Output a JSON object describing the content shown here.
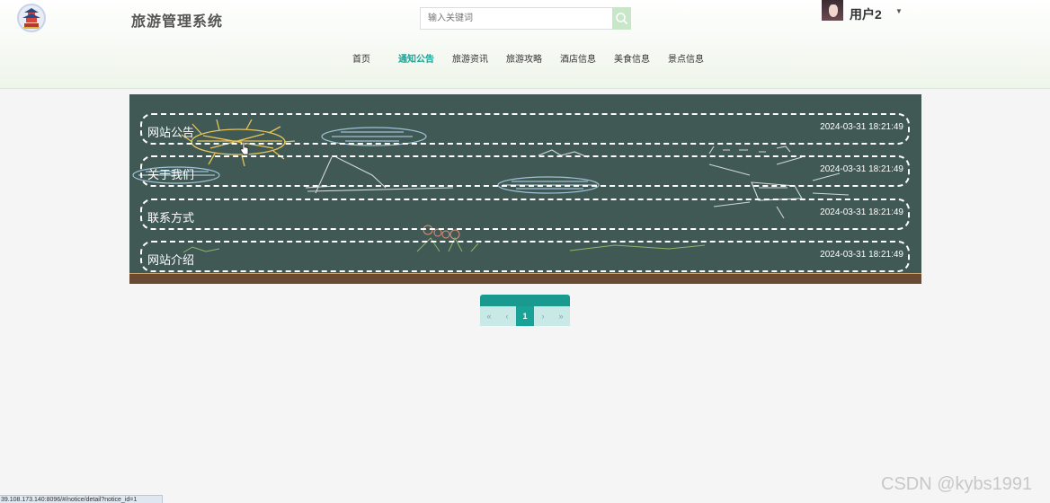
{
  "header": {
    "site_title": "旅游管理系统",
    "logo_icon": "temple-logo-icon",
    "search": {
      "placeholder": "输入关键词",
      "button_icon": "search-icon"
    },
    "user": {
      "name": "用户2",
      "dropdown_icon": "caret-down-icon"
    }
  },
  "nav": {
    "items": [
      {
        "label": "首页"
      },
      {
        "label": "通知公告"
      },
      {
        "label": "旅游资讯"
      },
      {
        "label": "旅游攻略"
      },
      {
        "label": "酒店信息"
      },
      {
        "label": "美食信息"
      },
      {
        "label": "景点信息"
      }
    ],
    "active": "通知公告"
  },
  "notices": [
    {
      "title": "网站公告",
      "date": "2024-03-31 18:21:49"
    },
    {
      "title": "关于我们",
      "date": "2024-03-31 18:21:49"
    },
    {
      "title": "联系方式",
      "date": "2024-03-31 18:21:49"
    },
    {
      "title": "网站介绍",
      "date": "2024-03-31 18:21:49"
    }
  ],
  "pagination": {
    "first": "«",
    "prev": "‹",
    "current_page": "1",
    "next": "›",
    "last": "»"
  },
  "watermark": "CSDN @kybs1991",
  "status_url": "39.108.173.140:8096/#/notice/detail?notice_id=1",
  "colors": {
    "accent": "#19a396",
    "board": "#405954",
    "header_bg": "#eef5ea"
  }
}
